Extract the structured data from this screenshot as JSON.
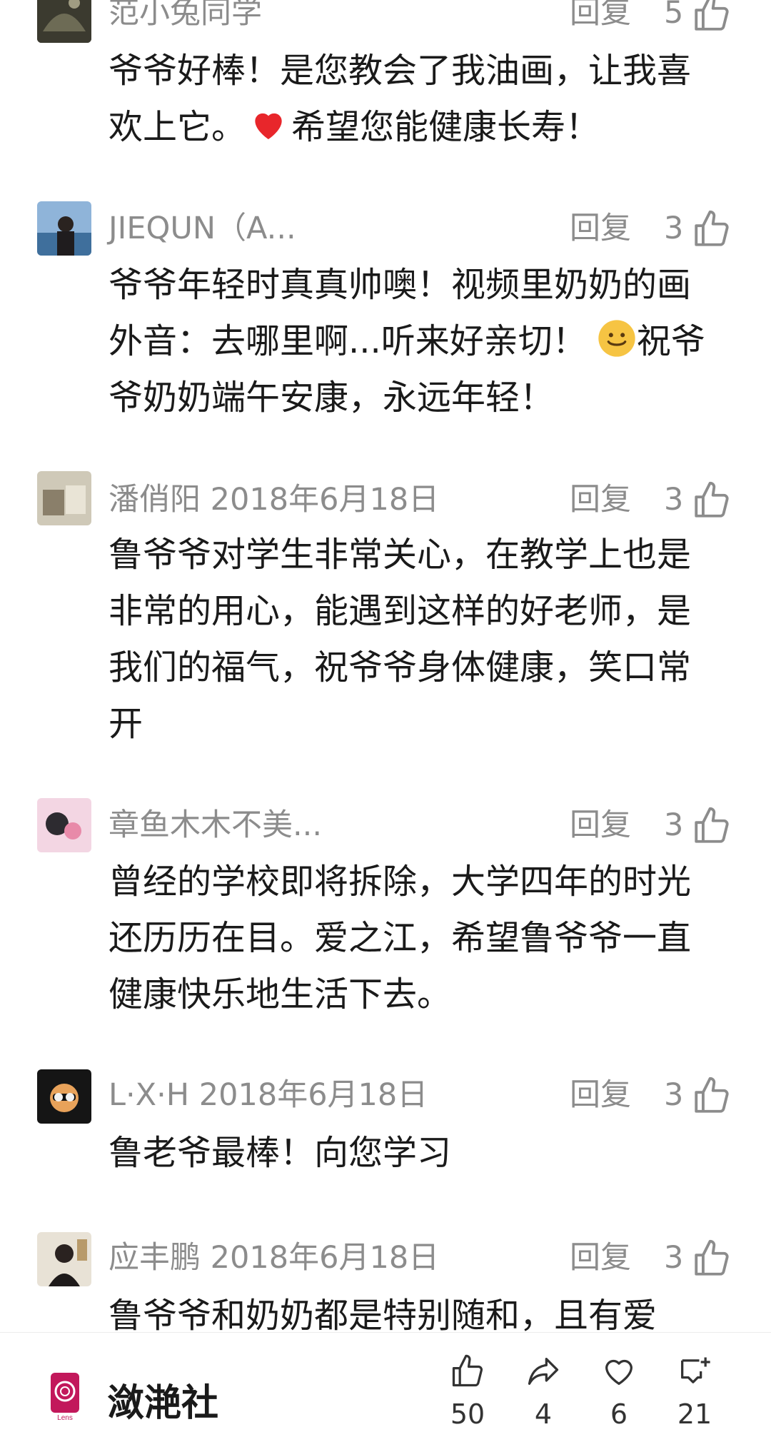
{
  "comments": [
    {
      "author": "范小兔同学",
      "date": "",
      "reply_label": "回复",
      "likes": "5",
      "text_before": "爷爷好棒！是您教会了我油画，让我喜欢上它。",
      "emoji": "heart",
      "text_after": "希望您能健康长寿！"
    },
    {
      "author": "JIEQUN（A...",
      "date": "",
      "reply_label": "回复",
      "likes": "3",
      "text_before": "爷爷年轻时真真帅噢！视频里奶奶的画外音：去哪里啊...听来好亲切！",
      "emoji": "smile",
      "text_after": "祝爷爷奶奶端午安康，永远年轻！"
    },
    {
      "author": "潘俏阳",
      "date": "2018年6月18日",
      "reply_label": "回复",
      "likes": "3",
      "text": "鲁爷爷对学生非常关心，在教学上也是非常的用心，能遇到这样的好老师，是我们的福气，祝爷爷身体健康，笑口常开"
    },
    {
      "author": "章鱼木木不美...",
      "date": "",
      "reply_label": "回复",
      "likes": "3",
      "text": "曾经的学校即将拆除，大学四年的时光还历历在目。爱之江，希望鲁爷爷一直健康快乐地生活下去。"
    },
    {
      "author": "L·X·H",
      "date": "2018年6月18日",
      "reply_label": "回复",
      "likes": "3",
      "text": "鲁老爷最棒！向您学习"
    },
    {
      "author": "应丰鹏",
      "date": "2018年6月18日",
      "reply_label": "回复",
      "likes": "3",
      "text": "鲁爷爷和奶奶都是特别随和，且有爱"
    }
  ],
  "bottom_bar": {
    "channel_name": "潋滟社",
    "logo_text": "Lens",
    "actions": [
      {
        "icon": "thumbs-up-icon",
        "count": "50"
      },
      {
        "icon": "share-icon",
        "count": "4"
      },
      {
        "icon": "heart-icon",
        "count": "6"
      },
      {
        "icon": "comment-add-icon",
        "count": "21"
      }
    ]
  },
  "colors": {
    "meta_gray": "#8c8c8c",
    "text_dark": "#1a1a1a",
    "heart_red": "#e8262b",
    "logo_magenta": "#c2185b"
  }
}
